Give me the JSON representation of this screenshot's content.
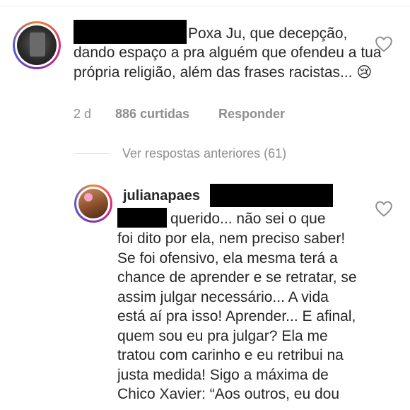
{
  "comment1": {
    "text_first": "Poxa Ju, que decepção,",
    "text_rest": "dando espaço a pra alguém que ofendeu a tua própria religião, além das frases racistas... 😢",
    "time": "2 d",
    "likes": "886 curtidas",
    "reply": "Responder"
  },
  "view_previous": "Ver respostas anteriores (61)",
  "comment2": {
    "username": "julianapaes",
    "text_first": "querido... não sei o que",
    "text_rest": "foi dito por ela, nem preciso saber! Se foi ofensivo, ela mesma terá a chance de aprender e se retratar, se assim julgar necessário... A vida está aí pra isso! Aprender... E afinal, quem sou eu pra julgar? Ela me tratou com carinho e eu retribui na justa medida! Sigo a máxima de Chico Xavier: “Aos outros, eu dou"
  },
  "icons": {
    "like": "heart-outline-icon"
  },
  "colors": {
    "text": "#262626",
    "muted": "#8e8e8e",
    "redaction": "#000000"
  }
}
